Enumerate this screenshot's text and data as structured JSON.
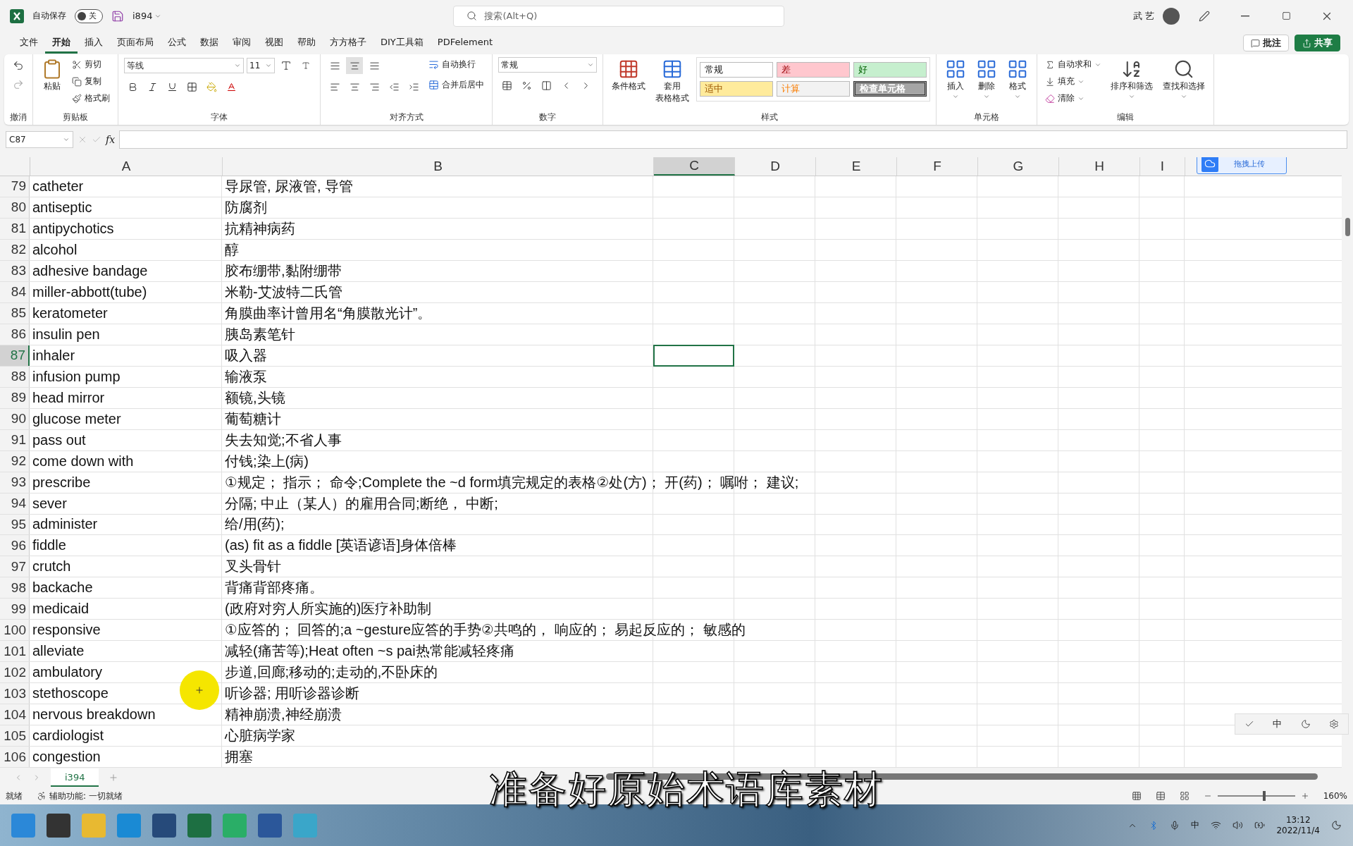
{
  "title_bar": {
    "autosave_label": "自动保存",
    "autosave_on": false,
    "autosave_state": "关",
    "filename": "i894",
    "search_placeholder": "搜索(Alt+Q)",
    "user": "武 艺"
  },
  "menu_tabs": [
    {
      "label": "文件",
      "selected": false
    },
    {
      "label": "开始",
      "selected": true
    },
    {
      "label": "插入",
      "selected": false
    },
    {
      "label": "页面布局",
      "selected": false
    },
    {
      "label": "公式",
      "selected": false
    },
    {
      "label": "数据",
      "selected": false
    },
    {
      "label": "审阅",
      "selected": false
    },
    {
      "label": "视图",
      "selected": false
    },
    {
      "label": "帮助",
      "selected": false
    },
    {
      "label": "方方格子",
      "selected": false
    },
    {
      "label": "DIY工具箱",
      "selected": false
    },
    {
      "label": "PDFelement",
      "selected": false
    }
  ],
  "actions": [
    {
      "kind": "comment",
      "label": "批注"
    },
    {
      "kind": "share",
      "label": "共享"
    }
  ],
  "ribbon": [
    {
      "kind": "undo",
      "label": "撤消"
    },
    {
      "kind": "clipboard",
      "label": "剪贴板",
      "paste": "粘贴",
      "items": [
        "剪切",
        "复制",
        "格式刷"
      ]
    },
    {
      "kind": "font",
      "label": "字体",
      "font": "等线",
      "size": "11"
    },
    {
      "kind": "alignment",
      "label": "对齐方式",
      "items": [
        "自动换行",
        "合并后居中"
      ]
    },
    {
      "kind": "number",
      "label": "数字",
      "format": "常规"
    },
    {
      "kind": "styles",
      "label": "样式",
      "buttons": [
        [
          "条件格式"
        ],
        [
          "套用",
          "表格格式"
        ]
      ],
      "cell_styles": [
        {
          "label": "常规",
          "color": "#ffffff"
        },
        {
          "label": "差",
          "color": "#ffc7ce"
        },
        {
          "label": "好",
          "color": "#c6efce"
        },
        {
          "label": "适中",
          "color": "#ffeb9c"
        },
        {
          "label": "计算",
          "color": "#f2f2f2"
        },
        {
          "label": "检查单元格",
          "color": "#a5a5a5"
        }
      ]
    },
    {
      "kind": "cells",
      "label": "单元格",
      "buttons": [
        "插入",
        "删除",
        "格式"
      ]
    },
    {
      "kind": "editing",
      "label": "编辑",
      "items": [
        "自动求和",
        "填充",
        "清除"
      ],
      "buttons": [
        "排序和筛选",
        "查找和选择"
      ]
    }
  ],
  "formula_bar": {
    "name_box": "C87",
    "fx": "fx"
  },
  "cloud_upload": {
    "label": "拖拽上传"
  },
  "columns": [
    {
      "label": "A",
      "selected": false
    },
    {
      "label": "B",
      "selected": false
    },
    {
      "label": "C",
      "selected": true
    },
    {
      "label": "D",
      "selected": false
    },
    {
      "label": "E",
      "selected": false
    },
    {
      "label": "F",
      "selected": false
    },
    {
      "label": "G",
      "selected": false
    },
    {
      "label": "H",
      "selected": false
    },
    {
      "label": "I",
      "selected": false
    }
  ],
  "rows": [
    {
      "number": "79",
      "selected": false,
      "a": "catheter",
      "b": "导尿管, 尿液管, 导管"
    },
    {
      "number": "80",
      "selected": false,
      "a": "antiseptic",
      "b": "防腐剂"
    },
    {
      "number": "81",
      "selected": false,
      "a": "antipychotics",
      "b": "抗精神病药"
    },
    {
      "number": "82",
      "selected": false,
      "a": "alcohol",
      "b": "醇"
    },
    {
      "number": "83",
      "selected": false,
      "a": "adhesive bandage",
      "b": "胶布绷带,黏附绷带"
    },
    {
      "number": "84",
      "selected": false,
      "a": "miller-abbott(tube)",
      "b": "米勒-艾波特二氏管"
    },
    {
      "number": "85",
      "selected": false,
      "a": "keratometer",
      "b": "角膜曲率计曾用名“角膜散光计”。"
    },
    {
      "number": "86",
      "selected": false,
      "a": "insulin pen",
      "b": "胰岛素笔针"
    },
    {
      "number": "87",
      "selected": true,
      "a": "inhaler",
      "b": "吸入器"
    },
    {
      "number": "88",
      "selected": false,
      "a": "infusion pump",
      "b": "输液泵"
    },
    {
      "number": "89",
      "selected": false,
      "a": "head mirror",
      "b": "额镜,头镜"
    },
    {
      "number": "90",
      "selected": false,
      "a": "glucose meter",
      "b": "葡萄糖计"
    },
    {
      "number": "91",
      "selected": false,
      "a": "pass out",
      "b": "失去知觉;不省人事"
    },
    {
      "number": "92",
      "selected": false,
      "a": "come down with",
      "b": "付钱;染上(病)"
    },
    {
      "number": "93",
      "selected": false,
      "a": "prescribe",
      "b": "①规定； 指示； 命令;Complete the ~d form填完规定的表格②处(方)； 开(药)； 嘱咐； 建议;"
    },
    {
      "number": "94",
      "selected": false,
      "a": "sever",
      "b": "分隔; 中止（某人）的雇用合同;断绝， 中断;"
    },
    {
      "number": "95",
      "selected": false,
      "a": "administer",
      "b": "给/用(药);"
    },
    {
      "number": "96",
      "selected": false,
      "a": "fiddle",
      "b": "(as) fit as a fiddle [英语谚语]身体倍棒"
    },
    {
      "number": "97",
      "selected": false,
      "a": "crutch",
      "b": "叉头骨针"
    },
    {
      "number": "98",
      "selected": false,
      "a": "backache",
      "b": "背痛背部疼痛。"
    },
    {
      "number": "99",
      "selected": false,
      "a": "medicaid",
      "b": "(政府对穷人所实施的)医疗补助制"
    },
    {
      "number": "100",
      "selected": false,
      "a": "responsive",
      "b": "①应答的； 回答的;a ~gesture应答的手势②共鸣的， 响应的； 易起反应的； 敏感的"
    },
    {
      "number": "101",
      "selected": false,
      "a": "alleviate",
      "b": "减轻(痛苦等);Heat often ~s pai热常能减轻疼痛"
    },
    {
      "number": "102",
      "selected": false,
      "a": "ambulatory",
      "b": "步道,回廊;移动的;走动的,不卧床的"
    },
    {
      "number": "103",
      "selected": false,
      "a": "stethoscope",
      "b": "听诊器; 用听诊器诊断"
    },
    {
      "number": "104",
      "selected": false,
      "a": "nervous breakdown",
      "b": "精神崩溃,神经崩溃"
    },
    {
      "number": "105",
      "selected": false,
      "a": "cardiologist",
      "b": "心脏病学家"
    },
    {
      "number": "106",
      "selected": false,
      "a": "congestion",
      "b": "拥塞"
    }
  ],
  "ime_toolbar": {
    "label": "中"
  },
  "sheet_tabs": [
    {
      "label": "i394",
      "selected": true
    }
  ],
  "caption": "准备好原始术语库素材",
  "status_bar": {
    "ready": "就绪",
    "accessibility": "辅助功能: 一切就绪",
    "zoom": "160%",
    "zoom_slider": {
      "level": 0.6
    }
  },
  "tray": {
    "ime": "中",
    "time": "13:12",
    "date": "2022/11/4"
  }
}
